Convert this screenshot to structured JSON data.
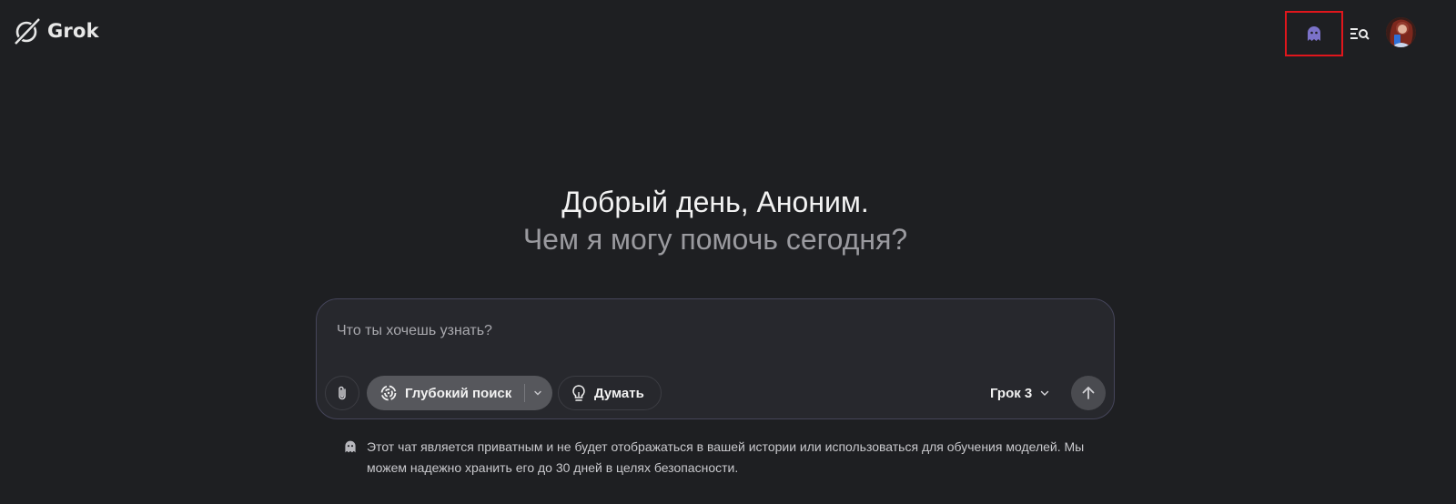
{
  "header": {
    "logo_text": "Grok",
    "private_chat_icon": "ghost-icon",
    "history_icon": "history-search-icon",
    "avatar_icon": "avatar"
  },
  "main": {
    "greeting": "Добрый день, Аноним.",
    "subgreeting": "Чем я могу помочь сегодня?"
  },
  "composer": {
    "placeholder": "Что ты хочешь узнать?",
    "value": "",
    "attach_icon": "paperclip-icon",
    "deepsearch_label": "Глубокий поиск",
    "deepsearch_icon": "deepsearch-icon",
    "think_label": "Думать",
    "think_icon": "lightbulb-icon",
    "model_label": "Грок 3",
    "send_icon": "arrow-up-icon"
  },
  "notice": {
    "text": "Этот чат является приватным и не будет отображаться в вашей истории или использоваться для обучения моделей. Мы можем надежно хранить его до 30 дней в целях безопасности.",
    "icon": "ghost-icon"
  },
  "colors": {
    "background": "#1e1f22",
    "ghost_accent": "#7b72c9",
    "highlight_box": "#e0161c",
    "deepsearch_bg": "#56575c"
  }
}
